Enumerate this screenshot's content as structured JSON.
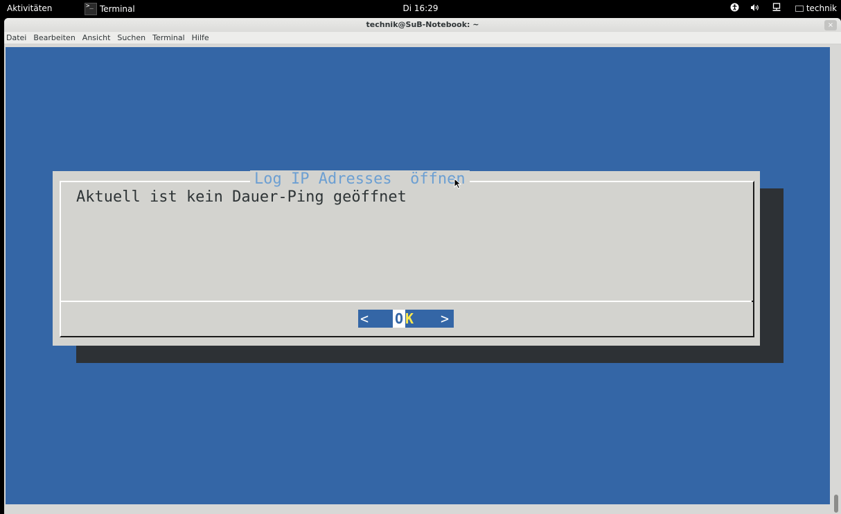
{
  "topbar": {
    "activities": "Aktivitäten",
    "app_name": "Terminal",
    "app_icon_text": ">_",
    "clock": "Di 16:29",
    "tray_icons": [
      "accessibility-icon",
      "volume-icon",
      "network-icon"
    ],
    "user": "technik"
  },
  "window": {
    "title": "technik@SuB-Notebook: ~",
    "close_symbol": "×",
    "menu": [
      "Datei",
      "Bearbeiten",
      "Ansicht",
      "Suchen",
      "Terminal",
      "Hilfe"
    ]
  },
  "dialog": {
    "title": "Log IP Adresses  öffnen",
    "message": "Aktuell ist kein Dauer-Ping geöffnet",
    "ok_left": "<",
    "ok_o": "O",
    "ok_k": "K",
    "ok_right": ">"
  },
  "colors": {
    "terminal_bg": "#3466a6",
    "dialog_bg": "#d3d3cf",
    "title_color": "#6c9fd2",
    "ok_highlight": "#fce94f"
  }
}
